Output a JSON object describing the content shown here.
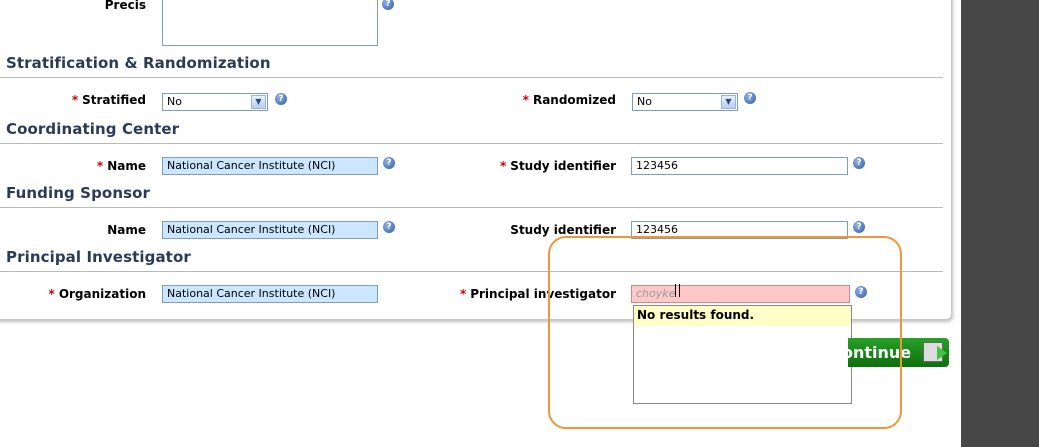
{
  "precis": {
    "label": "Precis"
  },
  "sections": {
    "stratification": "Stratification & Randomization",
    "coordinating": "Coordinating Center",
    "funding": "Funding Sponsor",
    "investigator": "Principal Investigator"
  },
  "stratification": {
    "stratified_label": "Stratified",
    "stratified_value": "No",
    "randomized_label": "Randomized",
    "randomized_value": "No"
  },
  "coordinating": {
    "name_label": "Name",
    "name_value": "National Cancer Institute (NCI)",
    "study_label": "Study identifier",
    "study_value": "123456"
  },
  "funding": {
    "name_label": "Name",
    "name_value": "National Cancer Institute (NCI)",
    "study_label": "Study identifier",
    "study_value": "123456"
  },
  "investigator": {
    "org_label": "Organization",
    "org_value": "National Cancer Institute (NCI)",
    "pi_label": "Principal investigator",
    "pi_value": "choyke",
    "dropdown_message": "No results found."
  },
  "required_marker": "*",
  "help_glyph": "?",
  "continue_label": "ontinue",
  "colors": {
    "section_title": "#2a3b57",
    "highlight": "#f0953a",
    "continue_bg": "#1a8a1a",
    "right_strip": "#474747"
  }
}
